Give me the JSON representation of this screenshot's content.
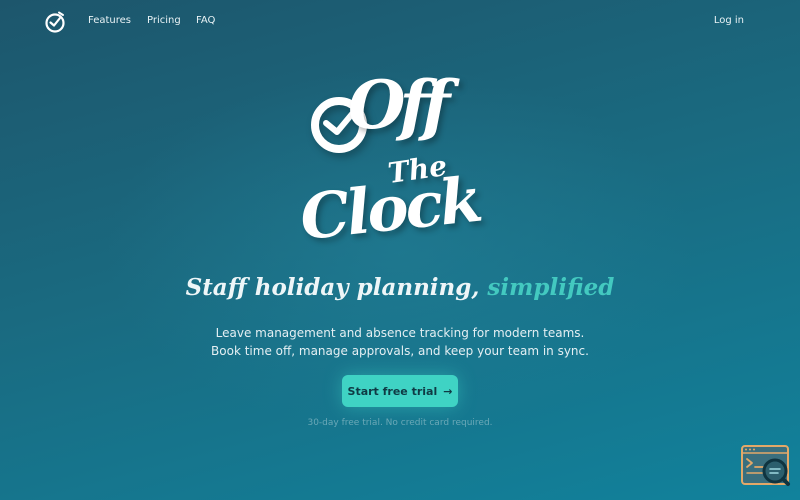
{
  "nav": {
    "features": "Features",
    "pricing": "Pricing",
    "faq": "FAQ",
    "login": "Log in"
  },
  "logo": {
    "word_1": "Off",
    "word_2": "The",
    "word_3": "Clock"
  },
  "hero": {
    "headline_main": "Staff holiday planning,",
    "headline_accent": "simplified",
    "sub_line_1": "Leave management and absence tracking for modern teams.",
    "sub_line_2": "Book time off, manage approvals, and keep your team in sync.",
    "cta_label": "Start free trial",
    "cta_arrow": "→",
    "note": "30-day free trial. No credit card required."
  },
  "colors": {
    "background_top": "#1d566c",
    "background_bottom": "#11829c",
    "accent": "#43c9c0",
    "cta": "#3fd3c4"
  },
  "icons": {
    "nav_logo": "clock-check-icon",
    "cta": "arrow-right-icon",
    "corner": "terminal-search-icon"
  }
}
